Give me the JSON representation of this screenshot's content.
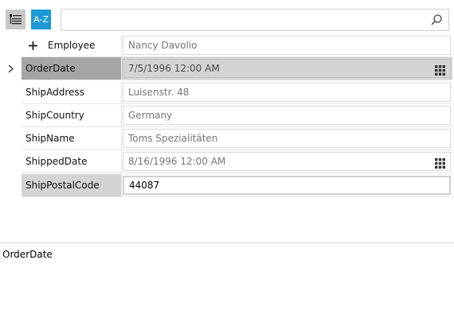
{
  "toolbar": {
    "az_label": "A-Z",
    "search_value": "",
    "search_placeholder": ""
  },
  "rows": [
    {
      "name": "Employee",
      "value": "Nancy Davolio",
      "expandable": true
    },
    {
      "name": "OrderDate",
      "value": "7/5/1996 12:00 AM",
      "selected": true
    },
    {
      "name": "ShipAddress",
      "value": "Luisenstr. 48"
    },
    {
      "name": "ShipCountry",
      "value": "Germany"
    },
    {
      "name": "ShipName",
      "value": "Toms Spezialitäten"
    },
    {
      "name": "ShippedDate",
      "value": "8/16/1996 12:00 AM"
    },
    {
      "name": "ShipPostalCode",
      "value": "44087",
      "editing": true
    }
  ],
  "description": {
    "title": "OrderDate",
    "text": ""
  },
  "colors": {
    "accent": "#1b9ad6",
    "selected_name_bg": "#a6a6a6",
    "selected_value_bg": "#d4d4d4"
  }
}
